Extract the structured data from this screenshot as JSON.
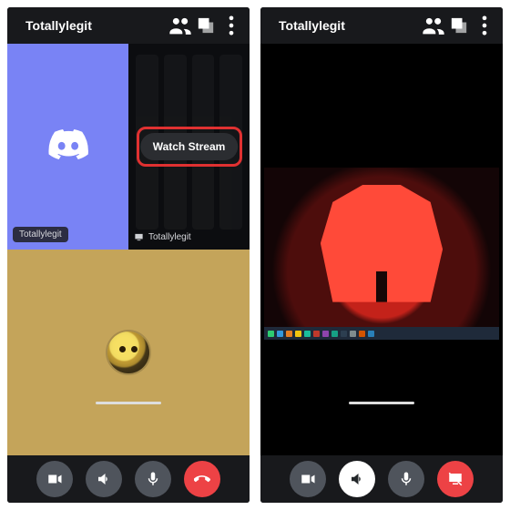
{
  "left": {
    "header": {
      "title": "Totallylegit"
    },
    "tiles": {
      "user_label": "Totallylegit",
      "stream_label": "Totallylegit",
      "watch_button": "Watch Stream"
    }
  },
  "right": {
    "header": {
      "title": "Totallylegit"
    }
  },
  "icons": {
    "chevron_down": "chevron-down-icon",
    "members": "members-icon",
    "popout": "popout-icon",
    "more": "more-icon",
    "camera": "camera-icon",
    "speaker": "speaker-icon",
    "mic": "mic-icon",
    "leave": "leave-call-icon",
    "stop_stream": "stop-stream-icon",
    "screen": "screen-share-icon",
    "discord": "discord-logo"
  },
  "taskbar_colors": [
    "#2ecc71",
    "#3498db",
    "#e67e22",
    "#f1c40f",
    "#1abc9c",
    "#c0392b",
    "#8e44ad",
    "#16a085",
    "#2c3e50",
    "#7f8c8d",
    "#d35400",
    "#2980b9"
  ]
}
